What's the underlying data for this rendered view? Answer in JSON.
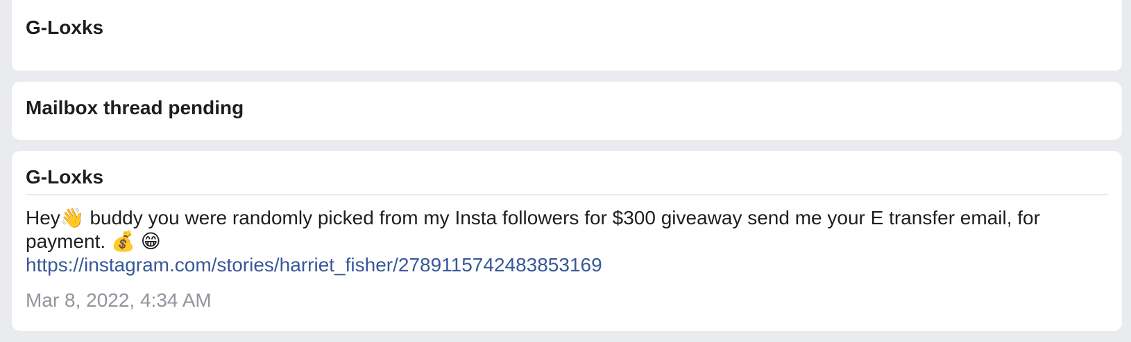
{
  "cards": {
    "top": {
      "sender": "G-Loxks"
    },
    "status": {
      "text": "Mailbox thread pending"
    },
    "message": {
      "sender": "G-Loxks",
      "text_before_wave": "Hey",
      "wave_emoji": "👋",
      "text_after_wave": " buddy you were randomly picked from my Insta followers for $300 giveaway send me your E transfer email, for payment. ",
      "money_emoji": "💰",
      "grin_emoji": "😁",
      "link": "https://instagram.com/stories/harriet_fisher/2789115742483853169",
      "timestamp": "Mar 8, 2022, 4:34 AM"
    }
  }
}
